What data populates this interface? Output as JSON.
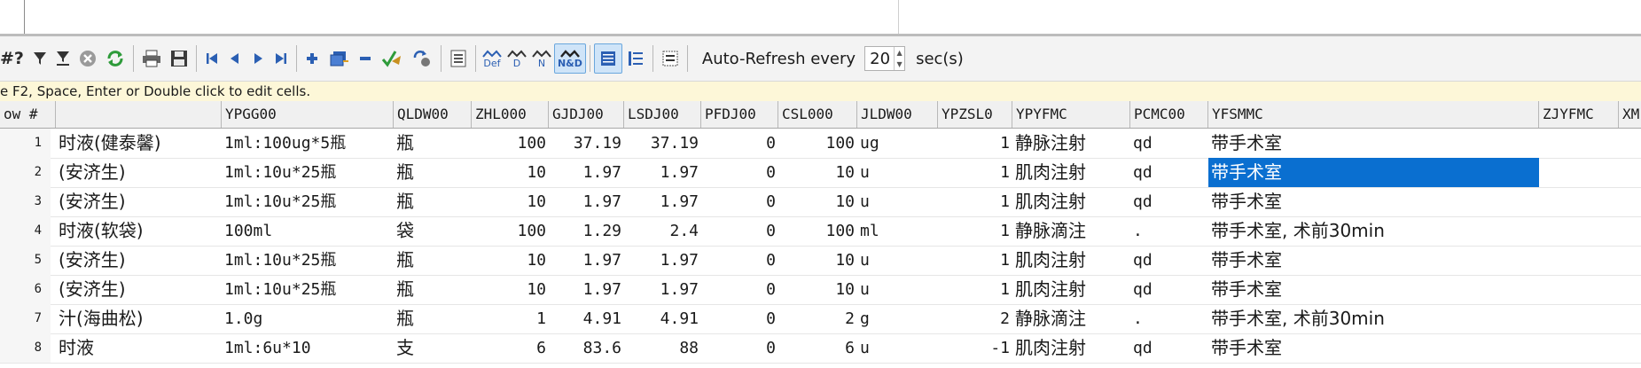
{
  "toolbar": {
    "auto_refresh_label": "Auto-Refresh every",
    "auto_refresh_value": "20",
    "auto_refresh_unit": "sec(s)",
    "partial_label": "#?",
    "def_label": "Def",
    "d_label": "D",
    "n_label": "N",
    "nd_label": "N&D"
  },
  "hint": "e F2, Space, Enter or Double click to edit cells.",
  "columns": {
    "rownum": "ow #",
    "name": "",
    "ypgg00": "YPGG00",
    "qldw00": "QLDW00",
    "zhl000": "ZHL000",
    "gjdj00": "GJDJ00",
    "lsdj00": "LSDJ00",
    "pfdj00": "PFDJ00",
    "csl000": "CSL000",
    "jldw00": "JLDW00",
    "ypzsl0": "YPZSL0",
    "ypyfmc": "YPYFMC",
    "pcmc00": "PCMC00",
    "yfsmmc": "YFSMMC",
    "zjyfmc": "ZJYFMC",
    "xm": "XM"
  },
  "rows": [
    {
      "n": "1",
      "name": "时液(健泰馨)",
      "ypgg00": "1ml:100ug*5瓶",
      "qldw00": "瓶",
      "zhl000": "100",
      "gjdj00": "37.19",
      "lsdj00": "37.19",
      "pfdj00": "0",
      "csl000": "100",
      "jldw00": "ug",
      "ypzsl0": "1",
      "ypyfmc": "静脉注射",
      "pcmc00": "qd",
      "yfsmmc": "带手术室"
    },
    {
      "n": "2",
      "name": "(安济生)",
      "ypgg00": "1ml:10u*25瓶",
      "qldw00": "瓶",
      "zhl000": "10",
      "gjdj00": "1.97",
      "lsdj00": "1.97",
      "pfdj00": "0",
      "csl000": "10",
      "jldw00": "u",
      "ypzsl0": "1",
      "ypyfmc": "肌肉注射",
      "pcmc00": "qd",
      "yfsmmc": "带手术室"
    },
    {
      "n": "3",
      "name": "(安济生)",
      "ypgg00": "1ml:10u*25瓶",
      "qldw00": "瓶",
      "zhl000": "10",
      "gjdj00": "1.97",
      "lsdj00": "1.97",
      "pfdj00": "0",
      "csl000": "10",
      "jldw00": "u",
      "ypzsl0": "1",
      "ypyfmc": "肌肉注射",
      "pcmc00": "qd",
      "yfsmmc": "带手术室"
    },
    {
      "n": "4",
      "name": "时液(软袋)",
      "ypgg00": "100ml",
      "qldw00": "袋",
      "zhl000": "100",
      "gjdj00": "1.29",
      "lsdj00": "2.4",
      "pfdj00": "0",
      "csl000": "100",
      "jldw00": "ml",
      "ypzsl0": "1",
      "ypyfmc": "静脉滴注",
      "pcmc00": ".",
      "yfsmmc": "带手术室, 术前30min"
    },
    {
      "n": "5",
      "name": "(安济生)",
      "ypgg00": "1ml:10u*25瓶",
      "qldw00": "瓶",
      "zhl000": "10",
      "gjdj00": "1.97",
      "lsdj00": "1.97",
      "pfdj00": "0",
      "csl000": "10",
      "jldw00": "u",
      "ypzsl0": "1",
      "ypyfmc": "肌肉注射",
      "pcmc00": "qd",
      "yfsmmc": "带手术室"
    },
    {
      "n": "6",
      "name": "(安济生)",
      "ypgg00": "1ml:10u*25瓶",
      "qldw00": "瓶",
      "zhl000": "10",
      "gjdj00": "1.97",
      "lsdj00": "1.97",
      "pfdj00": "0",
      "csl000": "10",
      "jldw00": "u",
      "ypzsl0": "1",
      "ypyfmc": "肌肉注射",
      "pcmc00": "qd",
      "yfsmmc": "带手术室"
    },
    {
      "n": "7",
      "name": "汁(海曲松)",
      "ypgg00": "1.0g",
      "qldw00": "瓶",
      "zhl000": "1",
      "gjdj00": "4.91",
      "lsdj00": "4.91",
      "pfdj00": "0",
      "csl000": "2",
      "jldw00": "g",
      "ypzsl0": "2",
      "ypyfmc": "静脉滴注",
      "pcmc00": ".",
      "yfsmmc": "带手术室, 术前30min"
    },
    {
      "n": "8",
      "name": "时液",
      "ypgg00": "1ml:6u*10",
      "qldw00": "支",
      "zhl000": "6",
      "gjdj00": "83.6",
      "lsdj00": "88",
      "pfdj00": "0",
      "csl000": "6",
      "jldw00": "u",
      "ypzsl0": "-1",
      "ypyfmc": "肌肉注射",
      "pcmc00": "qd",
      "yfsmmc": "带手术室"
    }
  ],
  "selected": {
    "row": 2,
    "column": "yfsmmc"
  }
}
